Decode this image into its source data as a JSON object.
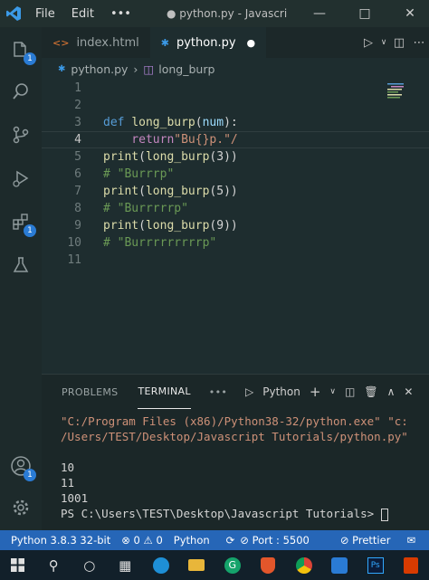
{
  "titlebar": {
    "menu": [
      "File",
      "Edit",
      "•••"
    ],
    "title": "● python.py - Javascri",
    "minimize": "—",
    "maximize": "□",
    "close": "✕"
  },
  "activity": {
    "explorer_badge": "1",
    "account_badge": "1"
  },
  "tabs": [
    {
      "label": "index.html",
      "icon": "html-file-icon"
    },
    {
      "label": "python.py",
      "icon": "python-file-icon",
      "modified_dot": "●"
    }
  ],
  "breadcrumb": {
    "file": "python.py",
    "symbol": "long_burp"
  },
  "editor": {
    "current_line": 4,
    "lines": [
      {
        "n": "1"
      },
      {
        "n": "2"
      },
      {
        "n": "3",
        "tokens": [
          {
            "t": "def ",
            "c": "kw"
          },
          {
            "t": "long_burp",
            "c": "fn"
          },
          {
            "t": "(",
            "c": "plain"
          },
          {
            "t": "num",
            "c": "prm"
          },
          {
            "t": "):",
            "c": "plain"
          }
        ]
      },
      {
        "n": "4",
        "tokens": [
          {
            "t": "    return",
            "c": "ctrl"
          },
          {
            "t": "\"Bu{}p.\"/",
            "c": "str"
          }
        ]
      },
      {
        "n": "5",
        "tokens": [
          {
            "t": "print",
            "c": "fn"
          },
          {
            "t": "(",
            "c": "plain"
          },
          {
            "t": "long_burp",
            "c": "fn"
          },
          {
            "t": "(3))",
            "c": "plain"
          }
        ]
      },
      {
        "n": "6",
        "tokens": [
          {
            "t": "# \"Burrrp\"",
            "c": "cmt"
          }
        ]
      },
      {
        "n": "7",
        "tokens": [
          {
            "t": "print",
            "c": "fn"
          },
          {
            "t": "(",
            "c": "plain"
          },
          {
            "t": "long_burp",
            "c": "fn"
          },
          {
            "t": "(5))",
            "c": "plain"
          }
        ]
      },
      {
        "n": "8",
        "tokens": [
          {
            "t": "# \"Burrrrrp\"",
            "c": "cmt"
          }
        ]
      },
      {
        "n": "9",
        "tokens": [
          {
            "t": "print",
            "c": "fn"
          },
          {
            "t": "(",
            "c": "plain"
          },
          {
            "t": "long_burp",
            "c": "fn"
          },
          {
            "t": "(9))",
            "c": "plain"
          }
        ]
      },
      {
        "n": "10",
        "tokens": [
          {
            "t": "# \"Burrrrrrrrrp\"",
            "c": "cmt"
          }
        ]
      },
      {
        "n": "11"
      }
    ]
  },
  "panel": {
    "tabs": [
      "PROBLEMS",
      "TERMINAL"
    ],
    "more": "•••",
    "shell": "Python",
    "terminal_lines": [
      {
        "text": "\"C:/Program Files (x86)/Python38-32/python.exe\" \"c:",
        "c": "str"
      },
      {
        "text": "/Users/TEST/Desktop/Javascript Tutorials/python.py\"",
        "c": "str"
      },
      {
        "text": "",
        "c": "plain"
      },
      {
        "text": "10",
        "c": "plain"
      },
      {
        "text": "11",
        "c": "plain"
      },
      {
        "text": "1001",
        "c": "plain"
      },
      {
        "text": "PS C:\\Users\\TEST\\Desktop\\Javascript Tutorials> ",
        "c": "plain"
      }
    ]
  },
  "status": {
    "interpreter": "Python 3.8.3 32-bit",
    "problems": "⊗ 0 ⚠ 0",
    "language": "Python",
    "port": "⊘ Port : 5500",
    "prettier": "⊘ Prettier"
  },
  "colors": {
    "status_bg": "#2666b7",
    "editor_bg": "#1e2d2f",
    "accent": "#2a7bd4"
  }
}
